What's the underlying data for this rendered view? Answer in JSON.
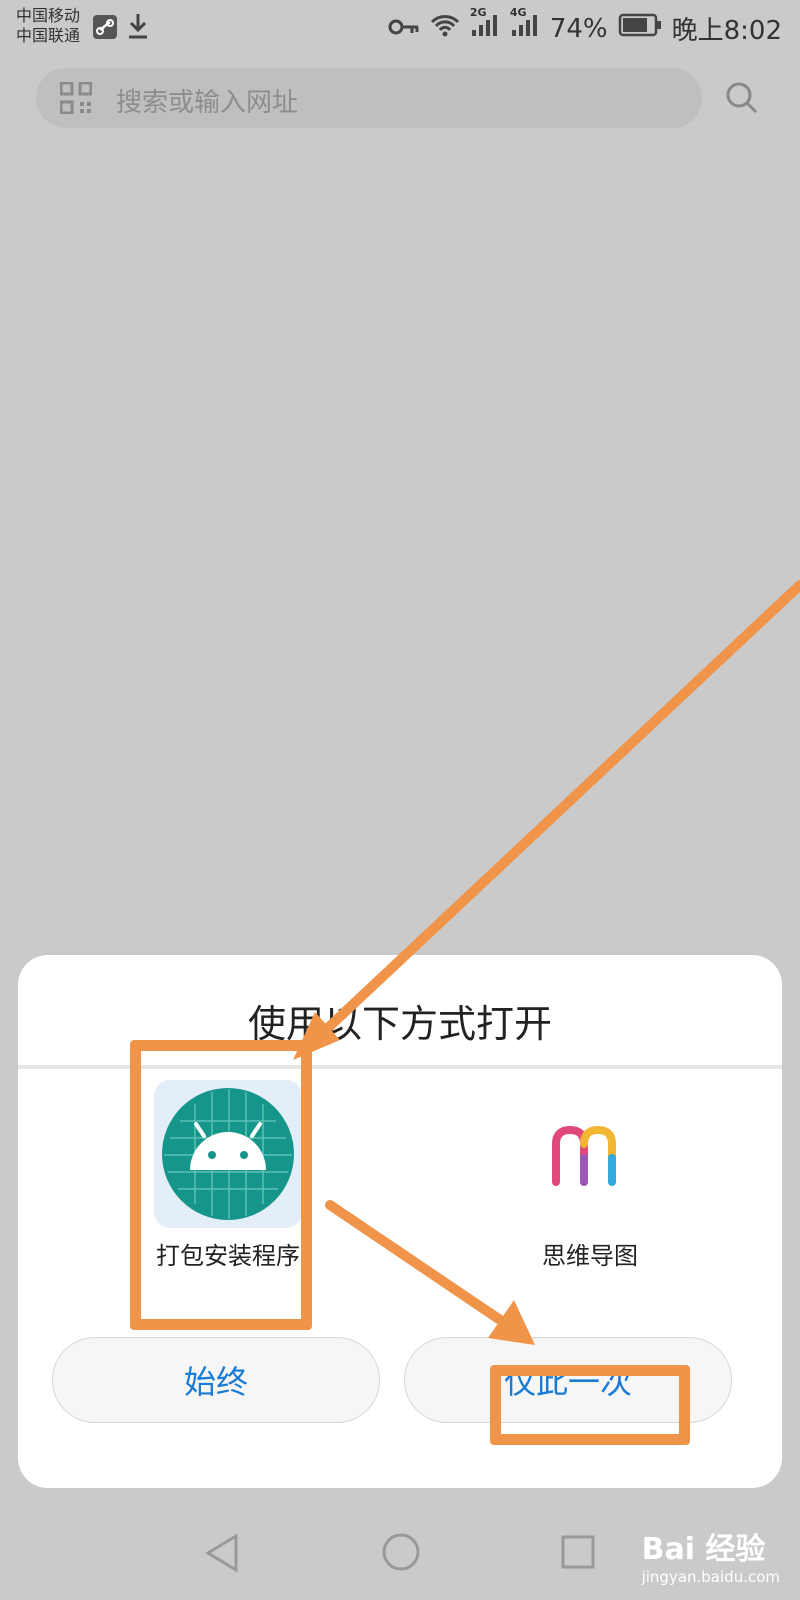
{
  "status_bar": {
    "carrier_1": "中国移动",
    "carrier_2": "中国联通",
    "network_1": "2G",
    "network_2": "4G",
    "battery": "74%",
    "time": "晚上8:02"
  },
  "search": {
    "placeholder": "搜索或输入网址",
    "scan_icon": "qr-scan-icon",
    "search_icon": "search-icon"
  },
  "dialog": {
    "title": "使用以下方式打开",
    "apps": [
      {
        "label": "打包安装程序",
        "icon": "android-package-installer-icon"
      },
      {
        "label": "思维导图",
        "icon": "mind-map-m-icon"
      }
    ],
    "buttons": {
      "always": "始终",
      "just_once": "仅此一次"
    }
  },
  "navbar": {
    "back": "back-icon",
    "home": "home-icon",
    "recents": "recents-icon"
  },
  "watermark": {
    "brand": "Bai 经验",
    "url": "jingyan.baidu.com"
  },
  "colors": {
    "annotation": "#f0944a",
    "accent": "#1a7bd6",
    "android_bg": "#16968a"
  }
}
